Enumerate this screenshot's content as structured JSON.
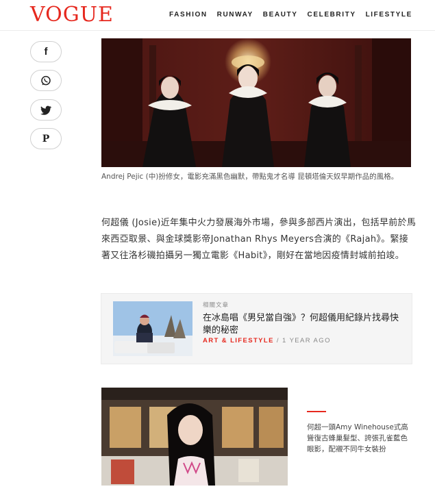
{
  "brand": {
    "logo_text": "VOGUE",
    "accent": "#e6281e"
  },
  "nav": [
    "FASHION",
    "RUNWAY",
    "BEAUTY",
    "CELEBRITY",
    "LIFESTYLE"
  ],
  "share": [
    {
      "icon": "facebook-icon",
      "glyph": "f"
    },
    {
      "icon": "whatsapp-icon"
    },
    {
      "icon": "twitter-icon"
    },
    {
      "icon": "pinterest-icon",
      "glyph": "P"
    }
  ],
  "article": {
    "hero_caption": "Andrej Pejic (中)扮修女，電影充滿黑色幽默，帶點鬼才名導 昆頓塔倫天奴早期作品的風格。",
    "body": "何超儀 (Josie)近年集中火力發展海外市場，參與多部西片演出，包括早前於馬來西亞取景、與金球獎影帝Jonathan Rhys Meyers合演的《Rajah》。緊接著又往洛杉磯拍攝另一獨立電影《Habit》，剛好在當地因疫情封城前拍竣。",
    "second_caption": "何超一頭Amy Winehouse式高聳復古蜂巢髮型、誇張孔雀藍色眼影，配襯不同牛女裝扮"
  },
  "related": {
    "label": "相關文章",
    "title": "在冰島唱《男兒當自強》？何超儀用紀錄片找尋快樂的秘密",
    "category": "ART & LIFESTYLE",
    "separator": "/",
    "time": "1 YEAR AGO"
  }
}
